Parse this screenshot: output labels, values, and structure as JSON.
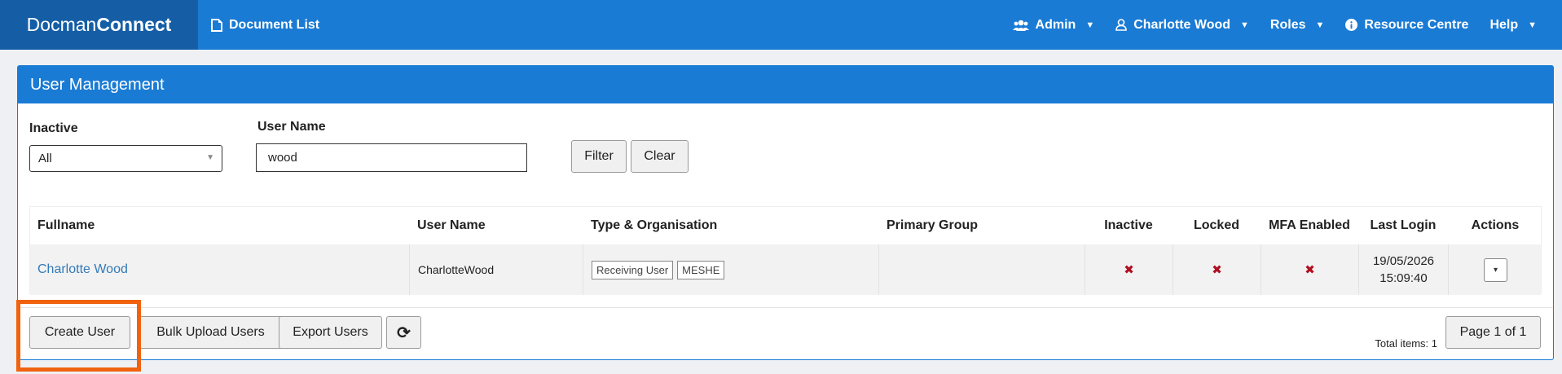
{
  "navbar": {
    "brand_part1": "Docman",
    "brand_part2": "Connect",
    "document_list": "Document List",
    "admin": "Admin",
    "user": "Charlotte Wood",
    "roles": "Roles",
    "resource_centre": "Resource Centre",
    "help": "Help"
  },
  "panel": {
    "title": "User Management"
  },
  "filters": {
    "inactive_label": "Inactive",
    "inactive_value": "All",
    "username_label": "User Name",
    "username_value": "wood",
    "filter_button": "Filter",
    "clear_button": "Clear"
  },
  "table": {
    "headers": [
      "Fullname",
      "User Name",
      "Type & Organisation",
      "Primary Group",
      "Inactive",
      "Locked",
      "MFA Enabled",
      "Last Login",
      "Actions"
    ],
    "rows": [
      {
        "fullname": "Charlotte Wood",
        "username": "CharlotteWood",
        "tags": [
          "Receiving User",
          "MESHE"
        ],
        "primary_group": "",
        "inactive": "✖",
        "locked": "✖",
        "mfa": "✖",
        "last_login_date": "19/05/2026",
        "last_login_time": "15:09:40",
        "actions": "▾"
      }
    ]
  },
  "footer": {
    "create_user": "Create User",
    "bulk_upload": "Bulk Upload Users",
    "export_users": "Export Users",
    "refresh_icon": "⟳",
    "total_items": "Total items: 1",
    "page_info": "Page 1 of 1"
  },
  "colors": {
    "navbar": "#1a7bd4",
    "brand": "#155ea6",
    "highlight": "#f0620e",
    "link": "#337ab7",
    "xmark": "#b01020"
  }
}
